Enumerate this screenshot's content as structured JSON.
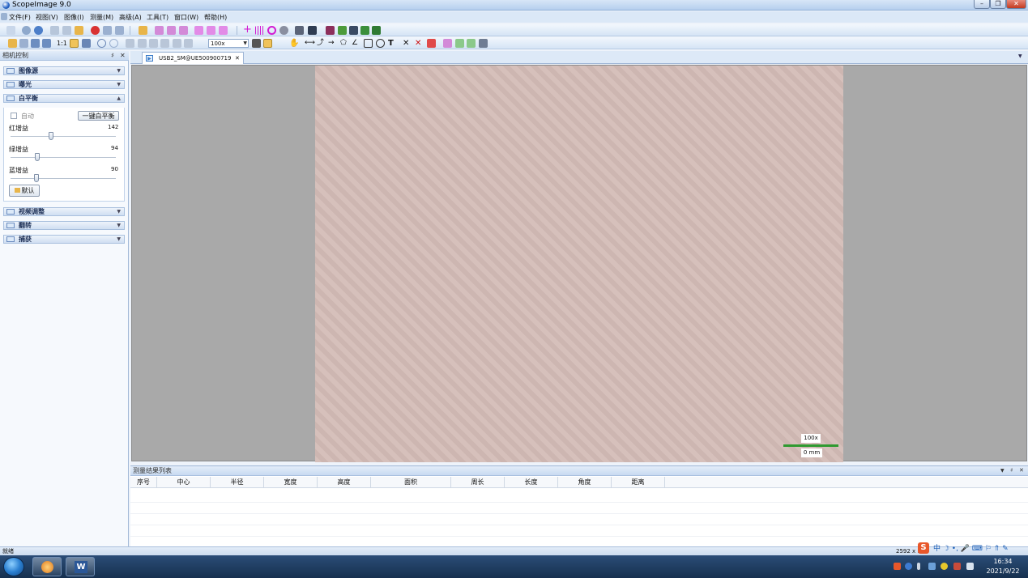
{
  "window": {
    "title": "ScopeImage 9.0",
    "controls": [
      "–",
      "❐",
      "✕"
    ]
  },
  "menu": [
    "文件(F)",
    "视图(V)",
    "图像(I)",
    "测量(M)",
    "高级(A)",
    "工具(T)",
    "窗口(W)",
    "帮助(H)"
  ],
  "toolbar": {
    "one_to_one": "1:1",
    "zoom_value": "100x"
  },
  "left_panel": {
    "title": "相机控制",
    "pin": "♯",
    "close": "✕",
    "sections": {
      "image_source": "图像源",
      "exposure": "曝光",
      "white_balance": "白平衡",
      "video_adjust": "视频调整",
      "flip": "翻转",
      "capture": "捕获"
    },
    "white_balance": {
      "auto_label": "自动",
      "one_click_button": "一键白平衡",
      "red_label": "红增益",
      "red_value": "142",
      "red_level": 0.39,
      "green_label": "绿增益",
      "green_value": "94",
      "green_level": 0.26,
      "blue_label": "蓝增益",
      "blue_value": "90",
      "blue_level": 0.25,
      "default_button": "默认"
    }
  },
  "document_tab": {
    "label": "USB2_SM@UE500900719",
    "close": "✕"
  },
  "view": {
    "scale_mag": "100x",
    "scale_length": "0 mm"
  },
  "results": {
    "title": "测量结果列表",
    "columns": [
      "序号",
      "中心",
      "半径",
      "宽度",
      "高度",
      "面积",
      "周长",
      "长度",
      "角度",
      "距离"
    ]
  },
  "status": {
    "left": "就绪",
    "resolution": "2592 x 1"
  },
  "taskbar": {
    "time": "16:34",
    "date": "2021/9/22"
  },
  "colors": {
    "scale_bar": "#2f9a30",
    "accent": "#2a67c9"
  }
}
